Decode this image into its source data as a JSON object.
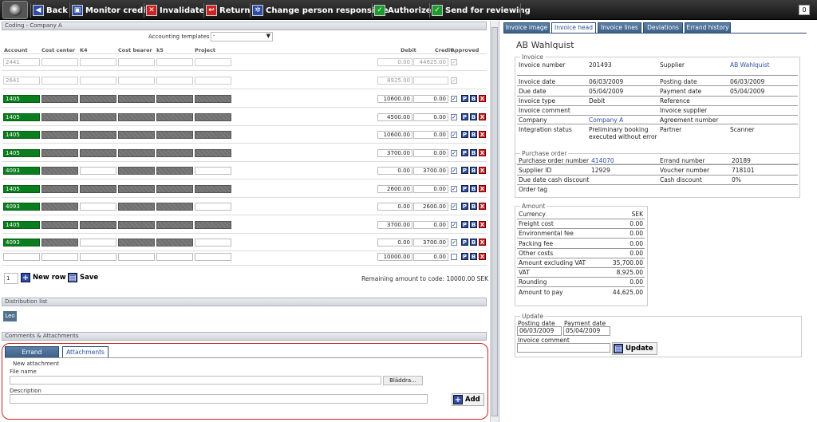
{
  "toolbar": {
    "back": "Back",
    "monitor_credit": "Monitor credit",
    "invalidate": "Invalidate",
    "return": "Return",
    "change_person": "Change person responsible",
    "authorize": "Authorize",
    "send_reviewing": "Send for reviewing",
    "lang": "0"
  },
  "coding": {
    "title": "Coding - Company A",
    "templates_label": "Accounting templates",
    "templates_value": "-",
    "headers": {
      "account": "Account",
      "cost_center": "Cost center",
      "k4": "K4",
      "cost_bearer": "Cost bearer",
      "k5": "k5",
      "project": "Project",
      "debit": "Debit",
      "credit": "Credit",
      "approved": "Approved"
    },
    "rows": [
      {
        "account": "2441",
        "debit": "0.00",
        "credit": "44625.00",
        "style": "dis"
      },
      {
        "account": "2641",
        "debit": "8925.00",
        "credit": "",
        "style": "dis"
      },
      {
        "account": "1405",
        "debit": "10600.00",
        "credit": "0.00",
        "style": "g"
      },
      {
        "account": "1405",
        "debit": "4500.00",
        "credit": "0.00",
        "style": "g"
      },
      {
        "account": "1405",
        "debit": "10600.00",
        "credit": "0.00",
        "style": "g"
      },
      {
        "account": "1405",
        "debit": "3700.00",
        "credit": "0.00",
        "style": "g"
      },
      {
        "account": "4093",
        "debit": "0.00",
        "credit": "3700.00",
        "style": "g4"
      },
      {
        "account": "1405",
        "debit": "2600.00",
        "credit": "0.00",
        "style": "g"
      },
      {
        "account": "4093",
        "debit": "0.00",
        "credit": "2600.00",
        "style": "g4"
      },
      {
        "account": "1405",
        "debit": "3700.00",
        "credit": "0.00",
        "style": "g"
      },
      {
        "account": "4093",
        "debit": "0.00",
        "credit": "3700.00",
        "style": "g4"
      },
      {
        "account": "",
        "debit": "10000.00",
        "credit": "0.00",
        "style": "new"
      }
    ],
    "new_row_count": "1",
    "new_row": "New row",
    "save": "Save",
    "remaining_label": "Remaining amount to code:",
    "remaining_value": "10000.00",
    "remaining_currency": "SEK",
    "p": "P",
    "b": "B",
    "x": "X",
    "check": "✓"
  },
  "distribution": {
    "title": "Distribution list",
    "person": "Leo"
  },
  "comments": {
    "title": "Comments & Attachments",
    "tab_errand": "Errand comments",
    "tab_attachments": "Attachments",
    "new_attachment": "New attachment",
    "file_name": "File name",
    "browse": "Bläddra...",
    "description": "Description",
    "add": "Add"
  },
  "tabs": [
    "Invoice image",
    "Invoice head",
    "Invoice lines",
    "Deviations",
    "Errand history"
  ],
  "supplier_title": "AB Wahlquist",
  "invoice": {
    "legend": "Invoice",
    "number_l": "Invoice number",
    "number": "201493",
    "supplier_l": "Supplier",
    "supplier": "AB Wahlquist",
    "date_l": "Invoice date",
    "date": "06/03/2009",
    "posting_l": "Posting date",
    "posting": "06/03/2009",
    "due_l": "Due date",
    "due": "05/04/2009",
    "paydate_l": "Payment date",
    "paydate": "05/04/2009",
    "type_l": "Invoice type",
    "type": "Debit",
    "ref_l": "Reference",
    "ref": "",
    "comment_l": "Invoice comment",
    "comment": "",
    "inv_supplier_l": "Invoice supplier",
    "inv_supplier": "",
    "company_l": "Company",
    "company": "Company A",
    "agreement_l": "Agreement number",
    "agreement": "",
    "integration_l": "Integration status",
    "integration": "Preliminary booking",
    "integration2": "executed without error",
    "partner_l": "Partner",
    "partner": "Scanner"
  },
  "purchase": {
    "legend": "Purchase order",
    "po_l": "Purchase order number",
    "po": "414070",
    "errand_l": "Errand number",
    "errand": "20189",
    "supplier_id_l": "Supplier ID",
    "supplier_id": "12929",
    "voucher_l": "Voucher number",
    "voucher": "718101",
    "cash_due_l": "Due date cash discount",
    "cash_due": "",
    "cash_disc_l": "Cash discount",
    "cash_disc": "0%",
    "tag_l": "Order tag",
    "tag": ""
  },
  "amount": {
    "legend": "Amount",
    "rows": [
      {
        "l": "Currency",
        "v": "SEK"
      },
      {
        "l": "Freight cost",
        "v": "0.00"
      },
      {
        "l": "Environmental fee",
        "v": "0.00"
      },
      {
        "l": "Packing fee",
        "v": "0.00"
      },
      {
        "l": "Other costs",
        "v": "0.00"
      },
      {
        "l": "Amount excluding VAT",
        "v": "35,700.00"
      },
      {
        "l": "VAT",
        "v": "8,925.00"
      },
      {
        "l": "Rounding",
        "v": "0.00"
      },
      {
        "l": "Amount to pay",
        "v": "44,625.00"
      }
    ]
  },
  "update": {
    "legend": "Update",
    "posting_l": "Posting date",
    "posting": "06/03/2009",
    "pay_l": "Payment date",
    "pay": "05/04/2009",
    "comment_l": "Invoice comment",
    "comment": "",
    "button": "Update"
  }
}
